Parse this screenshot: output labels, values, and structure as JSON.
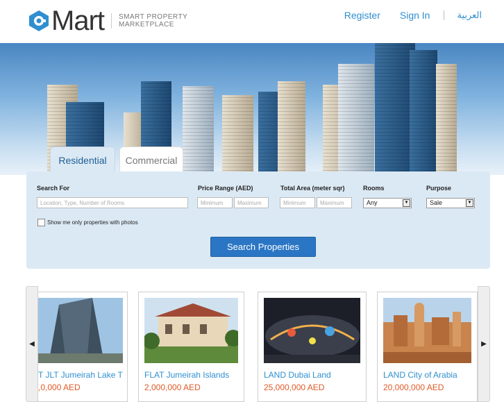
{
  "header": {
    "logo_word": "Mart",
    "logo_tag_line1": "SMART PROPERTY",
    "logo_tag_line2": "MARKETPLACE",
    "nav": {
      "register": "Register",
      "sign_in": "Sign In",
      "arabic": "العربية"
    }
  },
  "tabs": {
    "residential": "Residential",
    "commercial": "Commercial"
  },
  "search": {
    "search_for_label": "Search For",
    "search_for_placeholder": "Location, Type, Number of Rooms",
    "price_label": "Price Range (AED)",
    "price_min_placeholder": "Minimum",
    "price_max_placeholder": "Maximum",
    "area_label": "Total Area (meter sqr)",
    "area_min_placeholder": "Minimum",
    "area_max_placeholder": "Maximum",
    "rooms_label": "Rooms",
    "rooms_value": "Any",
    "purpose_label": "Purpose",
    "purpose_value": "Sale",
    "photos_only_label": "Show me only properties with photos",
    "submit_label": "Search Properties"
  },
  "listings": [
    {
      "title": "T JLT Jumeirah Lake T",
      "price": ",0,000 AED"
    },
    {
      "title": "FLAT Jumeirah Islands",
      "price": "2,000,000 AED"
    },
    {
      "title": "LAND Dubai Land",
      "price": "25,000,000 AED"
    },
    {
      "title": "LAND City of Arabia",
      "price": "20,000,000 AED"
    }
  ],
  "colors": {
    "accent": "#2f8fd0",
    "price": "#e05a28",
    "button": "#2b76c4",
    "panel": "#dbe9f4"
  }
}
